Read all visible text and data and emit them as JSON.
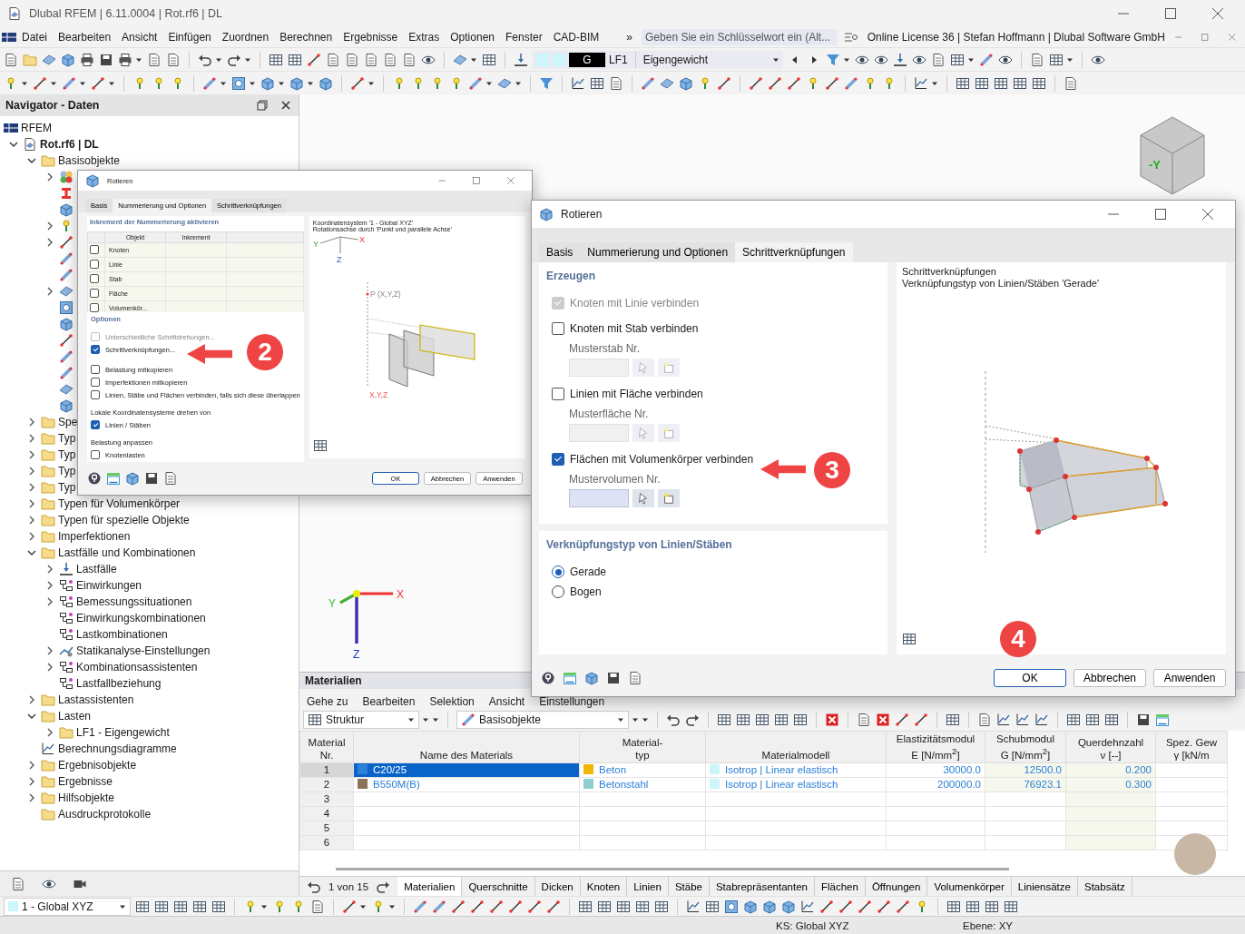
{
  "window": {
    "title": "Dlubal RFEM | 6.11.0004 | Rot.rf6 | DL"
  },
  "menu": [
    "Datei",
    "Bearbeiten",
    "Ansicht",
    "Einfügen",
    "Zuordnen",
    "Berechnen",
    "Ergebnisse",
    "Extras",
    "Optionen",
    "Fenster",
    "CAD-BIM"
  ],
  "menu_overflow": "»",
  "search": {
    "placeholder": "Geben Sie ein Schlüsselwort ein (Alt..."
  },
  "license": "Online License 36 | Stefan Hoffmann | Dlubal Software GmbH",
  "load_case": {
    "badge": "G",
    "code": "LF1",
    "name": "Eigengewicht"
  },
  "navigator": {
    "title": "Navigator - Daten",
    "root": "RFEM",
    "tree": [
      {
        "label": "Rot.rf6 | DL",
        "kind": "model",
        "bold": true,
        "expanded": true,
        "children": [
          {
            "label": "Basisobjekte",
            "kind": "folder",
            "expanded": true,
            "children": [
              {
                "kind": "material",
                "expanded": false
              },
              {
                "kind": "section"
              },
              {
                "kind": "box"
              },
              {
                "kind": "node",
                "expanded": false
              },
              {
                "kind": "line",
                "expanded": false
              },
              {
                "kind": "member"
              },
              {
                "kind": "member"
              },
              {
                "kind": "surface",
                "expanded": false
              },
              {
                "kind": "opening"
              },
              {
                "kind": "box"
              },
              {
                "kind": "line"
              },
              {
                "kind": "member"
              },
              {
                "kind": "member"
              },
              {
                "kind": "surface"
              },
              {
                "kind": "box"
              }
            ]
          },
          {
            "label": "Spe",
            "kind": "folder",
            "expanded": false
          },
          {
            "label": "Typ",
            "kind": "folder",
            "expanded": false
          },
          {
            "label": "Typ",
            "kind": "folder",
            "expanded": false
          },
          {
            "label": "Typ",
            "kind": "folder",
            "expanded": false
          },
          {
            "label": "Typ",
            "kind": "folder",
            "expanded": false
          },
          {
            "label": "Typen für Volumenkörper",
            "kind": "folder",
            "expanded": false
          },
          {
            "label": "Typen für spezielle Objekte",
            "kind": "folder",
            "expanded": false
          },
          {
            "label": "Imperfektionen",
            "kind": "folder",
            "expanded": false
          },
          {
            "label": "Lastfälle und Kombinationen",
            "kind": "folder",
            "expanded": true,
            "children": [
              {
                "label": "Lastfälle",
                "kind": "loadcase",
                "expanded": false
              },
              {
                "label": "Einwirkungen",
                "kind": "action",
                "expanded": false
              },
              {
                "label": "Bemessungssituationen",
                "kind": "action",
                "expanded": false
              },
              {
                "label": "Einwirkungskombinationen",
                "kind": "action"
              },
              {
                "label": "Lastkombinationen",
                "kind": "action"
              },
              {
                "label": "Statikanalyse-Einstellungen",
                "kind": "settings",
                "expanded": false
              },
              {
                "label": "Kombinationsassistenten",
                "kind": "action",
                "expanded": false
              },
              {
                "label": "Lastfallbeziehung",
                "kind": "action"
              }
            ]
          },
          {
            "label": "Lastassistenten",
            "kind": "folder",
            "expanded": false
          },
          {
            "label": "Lasten",
            "kind": "folder",
            "expanded": true,
            "children": [
              {
                "label": "LF1 - Eigengewicht",
                "kind": "folder",
                "expanded": false
              }
            ]
          },
          {
            "label": "Berechnungsdiagramme",
            "kind": "diagram"
          },
          {
            "label": "Ergebnisobjekte",
            "kind": "folder",
            "expanded": false
          },
          {
            "label": "Ergebnisse",
            "kind": "folder",
            "expanded": false
          },
          {
            "label": "Hilfsobjekte",
            "kind": "folder",
            "expanded": false
          },
          {
            "label": "Ausdruckprotokolle",
            "kind": "folder"
          }
        ]
      }
    ]
  },
  "viewport": {
    "cube_label": "-Y",
    "axes": [
      "X",
      "Y",
      "Z"
    ]
  },
  "materials": {
    "title": "Materialien",
    "menu": [
      "Gehe zu",
      "Bearbeiten",
      "Selektion",
      "Ansicht",
      "Einstellungen"
    ],
    "filter1": "Struktur",
    "filter2": "Basisobjekte",
    "columns": [
      {
        "head": [
          "Material",
          "Nr."
        ]
      },
      {
        "head": [
          "Name des Materials"
        ]
      },
      {
        "head": [
          "Material-",
          "typ"
        ]
      },
      {
        "head": [
          "Materialmodell"
        ]
      },
      {
        "head": [
          "Elastizitätsmodul",
          "E [N/mm$^{2}$]"
        ]
      },
      {
        "head": [
          "Schubmodul",
          "G [N/mm$^{2}$]"
        ]
      },
      {
        "head": [
          "Querdehnzahl",
          "ν [--]"
        ]
      },
      {
        "head": [
          "Spez. Gew",
          "γ [kN/m"
        ]
      }
    ],
    "rows": [
      {
        "nr": "1",
        "selected": true,
        "name": {
          "text": "C20/25",
          "color": "#2f80d8"
        },
        "type": {
          "text": "Beton",
          "color": "#f2b705"
        },
        "model": {
          "text": "Isotrop | Linear elastisch",
          "color": "#cdf6fb"
        },
        "e": "30000.0",
        "g": "12500.0",
        "nu": "0.200"
      },
      {
        "nr": "2",
        "selected": false,
        "name": {
          "text": "B550M(B)",
          "color": "#8a7356"
        },
        "type": {
          "text": "Betonstahl",
          "color": "#8fcfcf"
        },
        "model": {
          "text": "Isotrop | Linear elastisch",
          "color": "#cdf6fb"
        },
        "e": "200000.0",
        "g": "76923.1",
        "nu": "0.300"
      },
      {
        "nr": "3",
        "selected": false
      },
      {
        "nr": "4",
        "selected": false
      },
      {
        "nr": "5",
        "selected": false
      },
      {
        "nr": "6",
        "selected": false
      }
    ],
    "pager": "1 von 15",
    "tabs": [
      {
        "label": "Materialien",
        "selected": true
      },
      {
        "label": "Querschnitte",
        "selected": false
      },
      {
        "label": "Dicken",
        "selected": false
      },
      {
        "label": "Knoten",
        "selected": false
      },
      {
        "label": "Linien",
        "selected": false
      },
      {
        "label": "Stäbe",
        "selected": false
      },
      {
        "label": "Stabrepräsentanten",
        "selected": false
      },
      {
        "label": "Flächen",
        "selected": false
      },
      {
        "label": "Öffnungen",
        "selected": false
      },
      {
        "label": "Volumenkörper",
        "selected": false
      },
      {
        "label": "Liniensätze",
        "selected": false
      },
      {
        "label": "Stabsätz",
        "selected": false
      }
    ]
  },
  "dialog_back": {
    "title": "Rotieren",
    "tabs": [
      {
        "label": "Basis",
        "selected": false
      },
      {
        "label": "Nummerierung und Optionen",
        "selected": true
      },
      {
        "label": "Schrittverknüpfungen",
        "selected": false
      }
    ],
    "increment": {
      "title": "Inkrement der Nummerierung aktivieren",
      "columns": [
        "Objekt",
        "Inkrement"
      ],
      "rows": [
        {
          "label": "Knoten",
          "checked": false
        },
        {
          "label": "Linie",
          "checked": false
        },
        {
          "label": "Stab",
          "checked": false
        },
        {
          "label": "Fläche",
          "checked": false
        },
        {
          "label": "Volumenkör...",
          "checked": false
        }
      ]
    },
    "options": [
      {
        "kind": "heading",
        "label": "Optionen"
      },
      {
        "kind": "checkbox",
        "label": "Unterschiedliche Schrittdrehungen...",
        "checked": false,
        "disabled": true
      },
      {
        "kind": "checkbox",
        "label": "Schrittverknüpfungen...",
        "checked": true,
        "disabled": false
      },
      {
        "kind": "checkbox",
        "label": "Belastung mitkopieren",
        "checked": false,
        "disabled": false
      },
      {
        "kind": "checkbox",
        "label": "Imperfektionen mitkopieren",
        "checked": false,
        "disabled": false
      },
      {
        "kind": "checkbox",
        "label": "Linien, Stäbe und Flächen verbinden, falls sich diese überlappen",
        "checked": false,
        "disabled": false
      },
      {
        "kind": "label",
        "label": "Lokale Koordinatensysteme drehen von"
      },
      {
        "kind": "checkbox",
        "label": "Linien / Stäben",
        "checked": true,
        "disabled": false
      },
      {
        "kind": "label",
        "label": "Belastung anpassen"
      },
      {
        "kind": "checkbox",
        "label": "Knotenlasten",
        "checked": false,
        "disabled": false
      }
    ],
    "preview": {
      "lines": [
        "Koordinatensystem '1 - Global XYZ'",
        "Rotationsachse durch 'Punkt und parallele Achse'"
      ],
      "axes": [
        "Y",
        "X",
        "Z"
      ],
      "point": "P (X,Y,Z)",
      "base": "X,Y,Z"
    },
    "buttons": [
      "OK",
      "Abbrechen",
      "Anwenden"
    ]
  },
  "dialog_front": {
    "title": "Rotieren",
    "tabs": [
      {
        "label": "Basis",
        "selected": false
      },
      {
        "label": "Nummerierung und Optionen",
        "selected": false
      },
      {
        "label": "Schrittverknüpfungen",
        "selected": true
      }
    ],
    "sections": [
      {
        "title": "Erzeugen",
        "items": [
          {
            "kind": "checkbox",
            "label": "Knoten mit Linie verbinden",
            "checked": true,
            "disabled": true
          },
          {
            "kind": "checkbox",
            "label": "Knoten mit Stab verbinden",
            "checked": false,
            "disabled": false
          },
          {
            "kind": "field",
            "label": "Musterstab Nr.",
            "disabled": true
          },
          {
            "kind": "checkbox",
            "label": "Linien mit Fläche verbinden",
            "checked": false,
            "disabled": false
          },
          {
            "kind": "field",
            "label": "Musterfläche Nr.",
            "disabled": true
          },
          {
            "kind": "checkbox",
            "label": "Flächen mit Volumenkörper verbinden",
            "checked": true,
            "disabled": false
          },
          {
            "kind": "field",
            "label": "Mustervolumen Nr.",
            "disabled": false
          }
        ]
      },
      {
        "title": "Verknüpfungstyp von Linien/Stäben",
        "items": [
          {
            "kind": "radio",
            "label": "Gerade",
            "selected": true
          },
          {
            "kind": "radio",
            "label": "Bogen",
            "selected": false
          }
        ]
      }
    ],
    "preview": {
      "lines": [
        "Schrittverknüpfungen",
        "Verknüpfungstyp von Linien/Stäben 'Gerade'"
      ]
    },
    "buttons": [
      "OK",
      "Abbrechen",
      "Anwenden"
    ]
  },
  "markers": [
    {
      "label": "2",
      "arrow": true
    },
    {
      "label": "3",
      "arrow": true
    },
    {
      "label": "4",
      "arrow": false
    }
  ],
  "status": {
    "coord_system": "1 - Global XYZ",
    "ks": "KS: Global XYZ",
    "plane": "Ebene: XY"
  }
}
